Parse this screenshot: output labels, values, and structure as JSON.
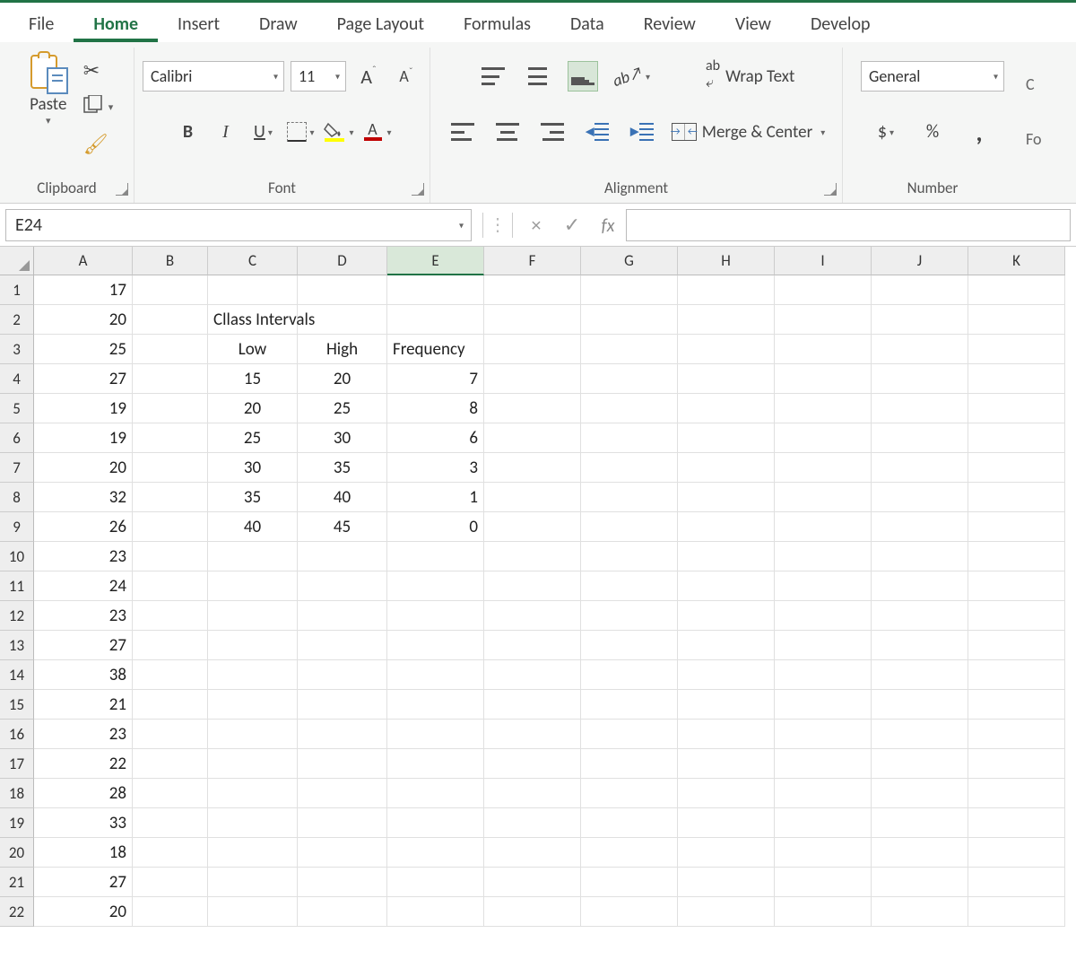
{
  "ribbon": {
    "tabs": [
      "File",
      "Home",
      "Insert",
      "Draw",
      "Page Layout",
      "Formulas",
      "Data",
      "Review",
      "View",
      "Develop"
    ],
    "active_tab": "Home",
    "clipboard": {
      "label": "Clipboard",
      "paste": "Paste"
    },
    "font": {
      "label": "Font",
      "name": "Calibri",
      "size": "11",
      "grow": "A",
      "grow_sup": "ˆ",
      "shrink": "A",
      "shrink_sup": "ˇ",
      "bold": "B",
      "italic": "I",
      "underline": "U"
    },
    "alignment": {
      "label": "Alignment",
      "wrap": "Wrap Text",
      "merge": "Merge & Center"
    },
    "number": {
      "label": "Number",
      "format": "General",
      "currency": "$",
      "percent": "%",
      "comma": ","
    },
    "cut_right": [
      "C",
      "Fo"
    ]
  },
  "formula_bar": {
    "name_box": "E24",
    "cancel": "×",
    "enter": "✓",
    "fx": "fx",
    "formula": ""
  },
  "grid": {
    "columns": [
      "A",
      "B",
      "C",
      "D",
      "E",
      "F",
      "G",
      "H",
      "I",
      "J",
      "K"
    ],
    "selected_col": "E",
    "row_count": 22,
    "col_A": [
      17,
      20,
      25,
      27,
      19,
      19,
      20,
      32,
      26,
      23,
      24,
      23,
      27,
      38,
      21,
      23,
      22,
      28,
      33,
      18,
      27,
      20
    ],
    "c2": "Cllass Intervals",
    "header_row3": {
      "C": "Low",
      "D": "High",
      "E": "Frequency"
    },
    "table": [
      {
        "low": 15,
        "high": 20,
        "freq": 7
      },
      {
        "low": 20,
        "high": 25,
        "freq": 8
      },
      {
        "low": 25,
        "high": 30,
        "freq": 6
      },
      {
        "low": 30,
        "high": 35,
        "freq": 3
      },
      {
        "low": 35,
        "high": 40,
        "freq": 1
      },
      {
        "low": 40,
        "high": 45,
        "freq": 0
      }
    ]
  }
}
